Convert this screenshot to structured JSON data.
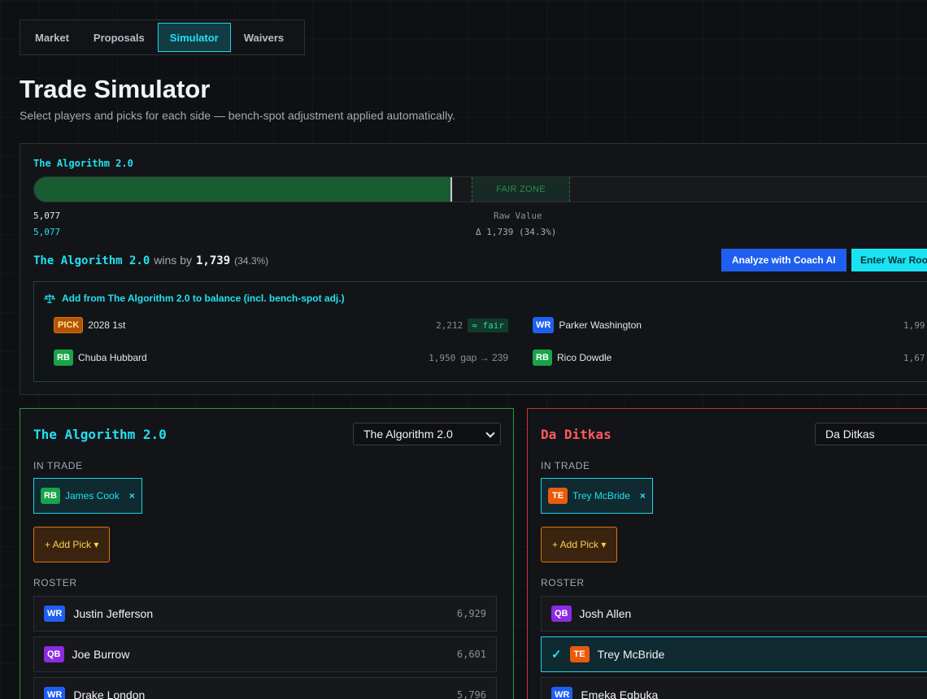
{
  "tabs": [
    {
      "label": "Market"
    },
    {
      "label": "Proposals"
    },
    {
      "label": "Simulator"
    },
    {
      "label": "Waivers"
    }
  ],
  "active_tab": "Simulator",
  "page": {
    "title": "Trade Simulator",
    "subtitle": "Select players and picks for each side — bench-spot adjustment applied automatically."
  },
  "value_panel": {
    "team_label": "The Algorithm 2.0",
    "fair_zone_label": "FAIR ZONE",
    "value_a": "5,077",
    "value_b": "5,077",
    "raw_value_label": "Raw Value",
    "delta": "Δ 1,739 (34.3%)",
    "verdict": {
      "team": "The Algorithm 2.0",
      "wins_by": "wins by",
      "amount": "1,739",
      "pct": "(34.3%)"
    },
    "analyze_button": "Analyze with Coach AI",
    "war_room_button": "Enter War Room"
  },
  "suggestions": {
    "header": "Add from The Algorithm 2.0 to balance (incl. bench-spot adj.)",
    "items": [
      {
        "pos": "PICK",
        "name": "2028 1st",
        "value": "2,212",
        "tag": "≈ fair"
      },
      {
        "pos": "WR",
        "name": "Parker Washington",
        "value": "1,99"
      },
      {
        "pos": "RB",
        "name": "Chuba Hubbard",
        "value": "1,950",
        "gap": "gap → 239"
      },
      {
        "pos": "RB",
        "name": "Rico Dowdle",
        "value": "1,67"
      }
    ]
  },
  "left_team": {
    "title": "The Algorithm 2.0",
    "select_value": "The Algorithm 2.0",
    "in_trade_label": "IN TRADE",
    "in_trade": [
      {
        "pos": "RB",
        "name": "James Cook",
        "remove": "×"
      }
    ],
    "add_pick_label": "+ Add Pick ▾",
    "roster_label": "ROSTER",
    "roster": [
      {
        "pos": "WR",
        "name": "Justin Jefferson",
        "value": "6,929"
      },
      {
        "pos": "QB",
        "name": "Joe Burrow",
        "value": "6,601"
      },
      {
        "pos": "WR",
        "name": "Drake London",
        "value": "5,796"
      }
    ]
  },
  "right_team": {
    "title": "Da Ditkas",
    "select_value": "Da Ditkas",
    "in_trade_label": "IN TRADE",
    "in_trade": [
      {
        "pos": "TE",
        "name": "Trey McBride",
        "remove": "×"
      }
    ],
    "add_pick_label": "+ Add Pick ▾",
    "roster_label": "ROSTER",
    "roster": [
      {
        "pos": "QB",
        "name": "Josh Allen"
      },
      {
        "pos": "TE",
        "name": "Trey McBride",
        "selected": true,
        "check": "✓"
      },
      {
        "pos": "WR",
        "name": "Emeka Egbuka"
      }
    ]
  },
  "value_comparison": {
    "fill_fraction": 0.462
  },
  "colors": {
    "accent": "#22e0f0",
    "left_border": "#1f9a49",
    "right_border": "#c0373c",
    "coach_button": "#1f5ff0",
    "war_button": "#19e3f2"
  }
}
